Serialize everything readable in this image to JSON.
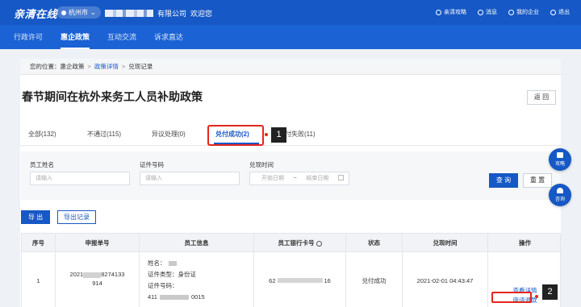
{
  "header": {
    "logo": "亲清在线",
    "city": "杭州市",
    "company_suffix": "有限公司",
    "welcome": "欢迎您",
    "links": [
      "亲清攻略",
      "消息",
      "我的企业",
      "退出"
    ]
  },
  "nav": {
    "items": [
      "行政许可",
      "惠企政策",
      "互动交流",
      "诉求直达"
    ],
    "active": "惠企政策"
  },
  "breadcrumb": {
    "prefix": "您的位置：",
    "items": [
      "惠企政策",
      "政策详情",
      "兑现记录"
    ]
  },
  "page": {
    "title": "春节期间在杭外来务工人员补助政策",
    "back_label": "返 回"
  },
  "tabs": [
    {
      "label": "全部(132)"
    },
    {
      "label": "不通过(115)"
    },
    {
      "label": "异议处理(0)"
    },
    {
      "label": "兑付成功(2)",
      "active": true
    },
    {
      "label": "兑付失败(11)"
    }
  ],
  "annotations": {
    "badge1": "1",
    "badge2": "2"
  },
  "filter": {
    "name_label": "员工姓名",
    "name_placeholder": "请输入",
    "id_label": "证件号码",
    "id_placeholder": "请输入",
    "time_label": "兑现时间",
    "start_placeholder": "开始日期",
    "range_sep": "~",
    "end_placeholder": "结束日期",
    "search_label": "查 询",
    "reset_label": "重 置"
  },
  "actions": {
    "export_label": "导 出",
    "export_record_label": "导出记录"
  },
  "table": {
    "columns": [
      "序号",
      "申报单号",
      "员工信息",
      "员工银行卡号",
      "状态",
      "兑现时间",
      "操作"
    ],
    "rows": [
      {
        "index": "1",
        "order_no_a": "2021",
        "order_no_b": "8274133",
        "order_no_c": "914",
        "name_label": "姓名：",
        "id_type_label": "证件类型：",
        "id_type": "身份证",
        "id_no_label": "证件号码：",
        "id_no_a": "411",
        "id_no_b": "0015",
        "bank_card_a": "62",
        "bank_card_b": "16",
        "status": "兑付成功",
        "time": "2021-02-01 04:43:47",
        "op_detail": "查看详情",
        "op_refund": "申请退款"
      }
    ]
  },
  "float": {
    "guide": "攻略",
    "consult": "咨询"
  },
  "colors": {
    "brand": "#1658c5",
    "highlight": "#e5261b"
  }
}
